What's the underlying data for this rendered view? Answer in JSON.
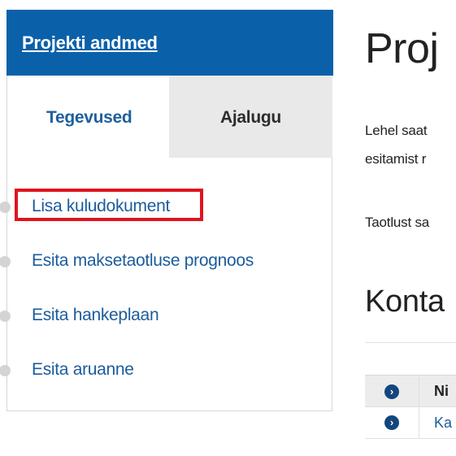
{
  "sidebar": {
    "header_title": "Projekti andmed",
    "tabs": [
      {
        "label": "Tegevused",
        "active": true
      },
      {
        "label": "Ajalugu",
        "active": false
      }
    ],
    "actions": [
      {
        "label": "Lisa kuludokument",
        "highlighted": true
      },
      {
        "label": "Esita maksetaotluse prognoos"
      },
      {
        "label": "Esita hankeplaan"
      },
      {
        "label": "Esita aruanne"
      }
    ]
  },
  "main": {
    "title": "Proj",
    "paragraph_line_1": "Lehel saat",
    "paragraph_line_2": "esitamist r",
    "paragraph_line_3": "Taotlust sa",
    "section_title": "Konta",
    "table": {
      "header_name": "Ni",
      "rows": [
        {
          "name": "Ka"
        }
      ]
    }
  },
  "colors": {
    "brand_blue": "#0a61aa",
    "link_blue": "#1c5c9c",
    "highlight_red": "#e0141e",
    "tab_inactive_bg": "#e9e9e9"
  }
}
